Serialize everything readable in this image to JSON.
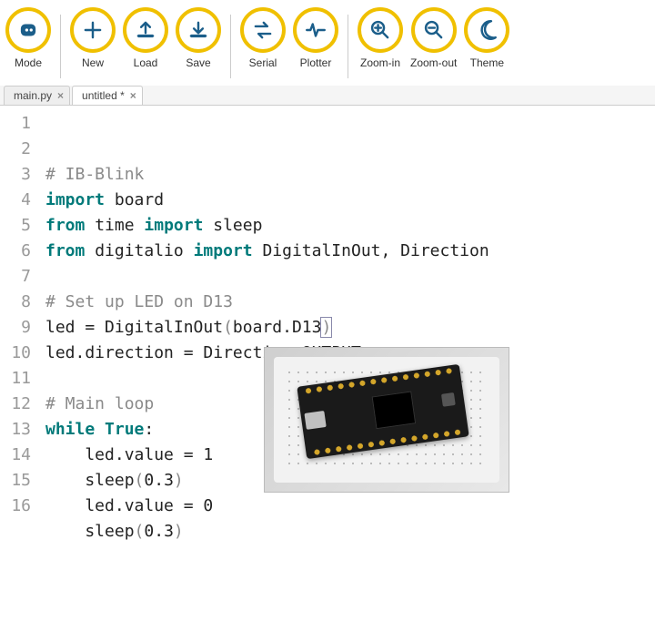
{
  "toolbar": {
    "groups": [
      [
        {
          "id": "mode",
          "label": "Mode"
        }
      ],
      [
        {
          "id": "new",
          "label": "New"
        },
        {
          "id": "load",
          "label": "Load"
        },
        {
          "id": "save",
          "label": "Save"
        }
      ],
      [
        {
          "id": "serial",
          "label": "Serial"
        },
        {
          "id": "plotter",
          "label": "Plotter"
        }
      ],
      [
        {
          "id": "zoom-in",
          "label": "Zoom-in"
        },
        {
          "id": "zoom-out",
          "label": "Zoom-out"
        },
        {
          "id": "theme",
          "label": "Theme"
        }
      ]
    ]
  },
  "tabs": [
    {
      "label": "main.py",
      "active": false,
      "dirty": false
    },
    {
      "label": "untitled *",
      "active": true,
      "dirty": true
    }
  ],
  "code": {
    "lines": [
      [
        {
          "t": "# IB-Blink",
          "c": "comment"
        }
      ],
      [
        {
          "t": "import",
          "c": "keyword"
        },
        {
          "t": " board",
          "c": "text"
        }
      ],
      [
        {
          "t": "from",
          "c": "keyword"
        },
        {
          "t": " time ",
          "c": "text"
        },
        {
          "t": "import",
          "c": "keyword"
        },
        {
          "t": " sleep",
          "c": "text"
        }
      ],
      [
        {
          "t": "from",
          "c": "keyword"
        },
        {
          "t": " digitalio ",
          "c": "text"
        },
        {
          "t": "import",
          "c": "keyword"
        },
        {
          "t": " DigitalInOut, Direction",
          "c": "text"
        }
      ],
      [],
      [
        {
          "t": "# Set up LED on D13",
          "c": "comment"
        }
      ],
      [
        {
          "t": "led = DigitalInOut",
          "c": "text"
        },
        {
          "t": "(",
          "c": "punc"
        },
        {
          "t": "board.D13",
          "c": "text"
        },
        {
          "t": ")",
          "c": "punc",
          "cursor": true
        }
      ],
      [
        {
          "t": "led.direction = Direction.OUTPUT",
          "c": "text"
        }
      ],
      [],
      [
        {
          "t": "# Main loop",
          "c": "comment"
        }
      ],
      [
        {
          "t": "while",
          "c": "keyword"
        },
        {
          "t": " ",
          "c": "text"
        },
        {
          "t": "True",
          "c": "keyword"
        },
        {
          "t": ":",
          "c": "text"
        }
      ],
      [
        {
          "t": "    led.value = ",
          "c": "text"
        },
        {
          "t": "1",
          "c": "text"
        }
      ],
      [
        {
          "t": "    sleep",
          "c": "text"
        },
        {
          "t": "(",
          "c": "punc"
        },
        {
          "t": "0.3",
          "c": "text"
        },
        {
          "t": ")",
          "c": "punc"
        }
      ],
      [
        {
          "t": "    led.value = ",
          "c": "text"
        },
        {
          "t": "0",
          "c": "text"
        }
      ],
      [
        {
          "t": "    sleep",
          "c": "text"
        },
        {
          "t": "(",
          "c": "punc"
        },
        {
          "t": "0.3",
          "c": "text"
        },
        {
          "t": ")",
          "c": "punc"
        }
      ],
      []
    ]
  },
  "icons": {
    "mode": "robot",
    "new": "plus",
    "load": "upload",
    "save": "download",
    "serial": "arrows",
    "plotter": "pulse",
    "zoom-in": "zoom-in",
    "zoom-out": "zoom-out",
    "theme": "moon"
  }
}
